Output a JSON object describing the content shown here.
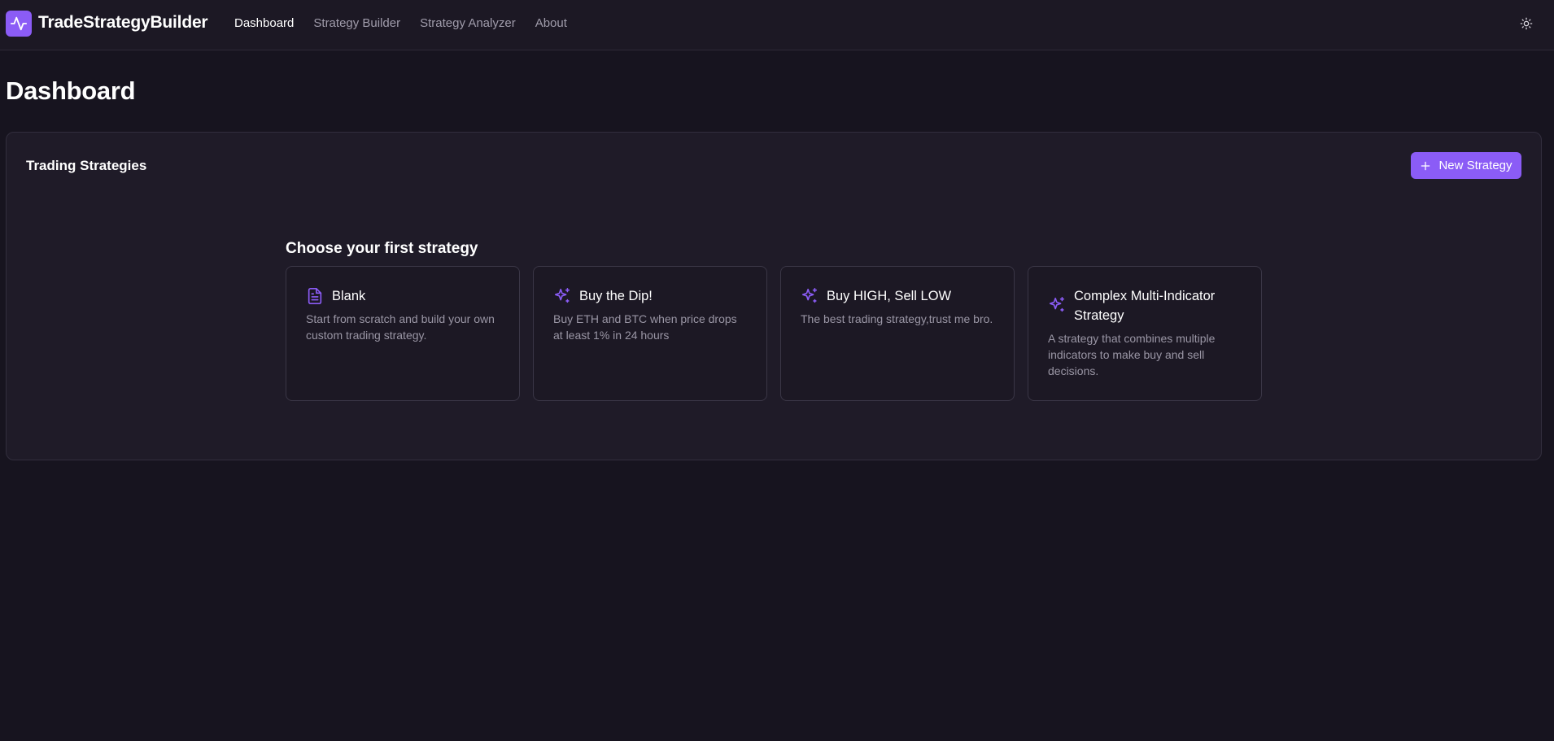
{
  "app": {
    "brand": "TradeStrategyBuilder"
  },
  "nav": {
    "items": [
      {
        "label": "Dashboard",
        "active": true
      },
      {
        "label": "Strategy Builder",
        "active": false
      },
      {
        "label": "Strategy Analyzer",
        "active": false
      },
      {
        "label": "About",
        "active": false
      }
    ]
  },
  "page": {
    "title": "Dashboard"
  },
  "panel": {
    "title": "Trading Strategies",
    "new_button_label": "New Strategy",
    "choose_title": "Choose your first strategy",
    "cards": [
      {
        "icon": "document-icon",
        "title": "Blank",
        "description": "Start from scratch and build your own custom trading strategy."
      },
      {
        "icon": "sparkles-icon",
        "title": "Buy the Dip!",
        "description": "Buy ETH and BTC when price drops at least 1% in 24 hours"
      },
      {
        "icon": "sparkles-icon",
        "title": "Buy HIGH, Sell LOW",
        "description": "The best trading strategy,trust me bro."
      },
      {
        "icon": "sparkles-icon",
        "title": "Complex Multi-Indicator Strategy",
        "description": "A strategy that combines multiple indicators to make buy and sell decisions."
      }
    ]
  },
  "colors": {
    "accent": "#8b5cf6",
    "background": "#17141f",
    "panel": "#1f1b28"
  }
}
